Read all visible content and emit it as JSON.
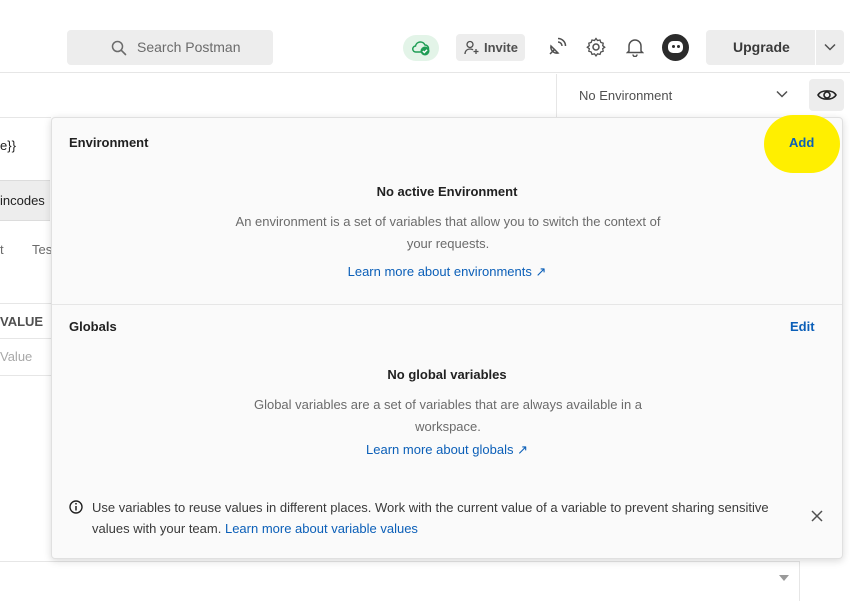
{
  "topbar": {
    "search_placeholder": "Search Postman",
    "invite_label": "Invite",
    "upgrade_label": "Upgrade"
  },
  "env_selector": {
    "selected": "No Environment"
  },
  "background": {
    "frag_var": "e}}",
    "frag_tab": "incodes",
    "frag_t": "t",
    "frag_tes": "Tes",
    "frag_value_header": "VALUE",
    "frag_value_placeholder": "Value"
  },
  "popover": {
    "environment": {
      "title": "Environment",
      "action": "Add",
      "empty_title": "No active Environment",
      "empty_desc": "An environment is a set of variables that allow you to switch the context of your requests.",
      "learn_link": "Learn more about environments ↗"
    },
    "globals": {
      "title": "Globals",
      "action": "Edit",
      "empty_title": "No global variables",
      "empty_desc": "Global variables are a set of variables that are always available in a workspace.",
      "learn_link": "Learn more about globals ↗"
    },
    "info": {
      "text": "Use variables to reuse values in different places. Work with the current value of a variable to prevent sharing sensitive values with your team.",
      "link": "Learn more about variable values"
    }
  },
  "colors": {
    "link": "#0b5fb8",
    "highlight": "#ffef00",
    "sync_bg": "#e3f4e8",
    "sync_check": "#1f9d55"
  },
  "icons": [
    "search-icon",
    "cloud-sync-icon",
    "add-user-icon",
    "satellite-icon",
    "gear-icon",
    "bell-icon",
    "avatar",
    "chevron-down-icon",
    "eye-icon",
    "info-icon",
    "close-icon"
  ]
}
